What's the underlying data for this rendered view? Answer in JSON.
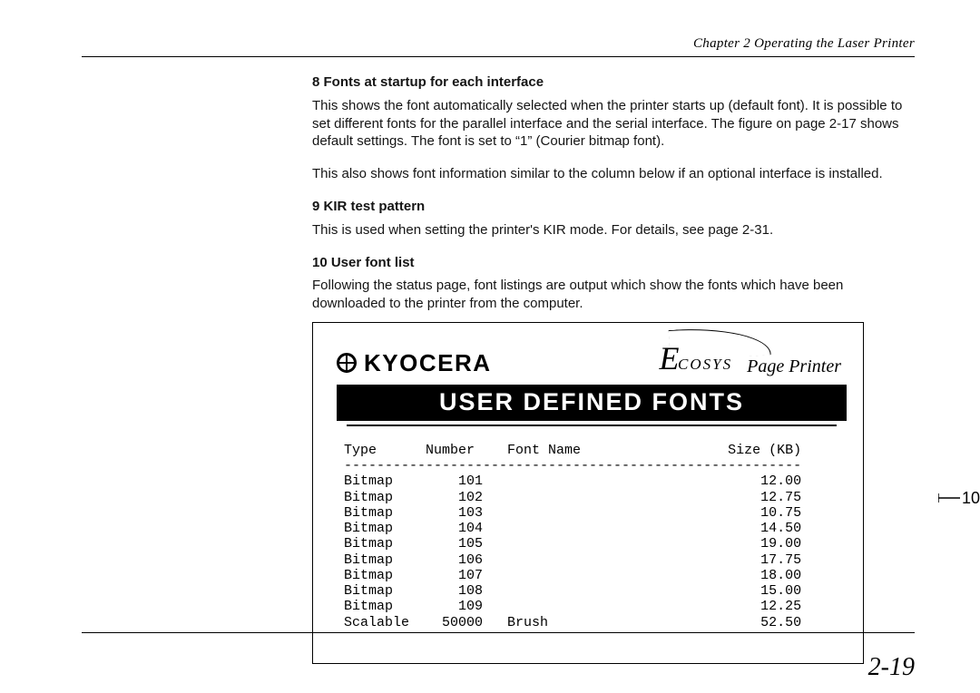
{
  "header": {
    "running": "Chapter 2  Operating the Laser Printer"
  },
  "sections": {
    "s8": {
      "title": "8   Fonts at startup for each interface",
      "p1": "This shows the font automatically selected when the printer starts up (default font).  It is possible to set different fonts for the parallel interface and the serial interface.  The figure on page 2-17 shows default settings.  The font is set to “1” (Courier bitmap font).",
      "p2": "This also shows font information similar to the column below if an optional interface is installed."
    },
    "s9": {
      "title": "9   KIR test pattern",
      "p1": "This is used when setting the printer's KIR mode.  For details, see page 2-31."
    },
    "s10": {
      "title": "10  User font list",
      "p1": "Following the status page, font listings are output which show the fonts which have been downloaded to the printer from the computer."
    }
  },
  "printout": {
    "brand": "KYOCERA",
    "product_line": "Ecosys",
    "tagline": "Page Printer",
    "bar_title": "USER DEFINED FONTS",
    "columns": {
      "type": "Type",
      "number": "Number",
      "name": "Font Name",
      "size": "Size (KB)"
    },
    "rows": [
      {
        "type": "Bitmap",
        "number": "101",
        "name": "",
        "size": "12.00"
      },
      {
        "type": "Bitmap",
        "number": "102",
        "name": "",
        "size": "12.75"
      },
      {
        "type": "Bitmap",
        "number": "103",
        "name": "",
        "size": "10.75"
      },
      {
        "type": "Bitmap",
        "number": "104",
        "name": "",
        "size": "14.50"
      },
      {
        "type": "Bitmap",
        "number": "105",
        "name": "",
        "size": "19.00"
      },
      {
        "type": "Bitmap",
        "number": "106",
        "name": "",
        "size": "17.75"
      },
      {
        "type": "Bitmap",
        "number": "107",
        "name": "",
        "size": "18.00"
      },
      {
        "type": "Bitmap",
        "number": "108",
        "name": "",
        "size": "15.00"
      },
      {
        "type": "Bitmap",
        "number": "109",
        "name": "",
        "size": "12.25"
      },
      {
        "type": "Scalable",
        "number": "50000",
        "name": "Brush",
        "size": "52.50"
      }
    ]
  },
  "callout": {
    "label": "10"
  },
  "page_number": "2-19"
}
